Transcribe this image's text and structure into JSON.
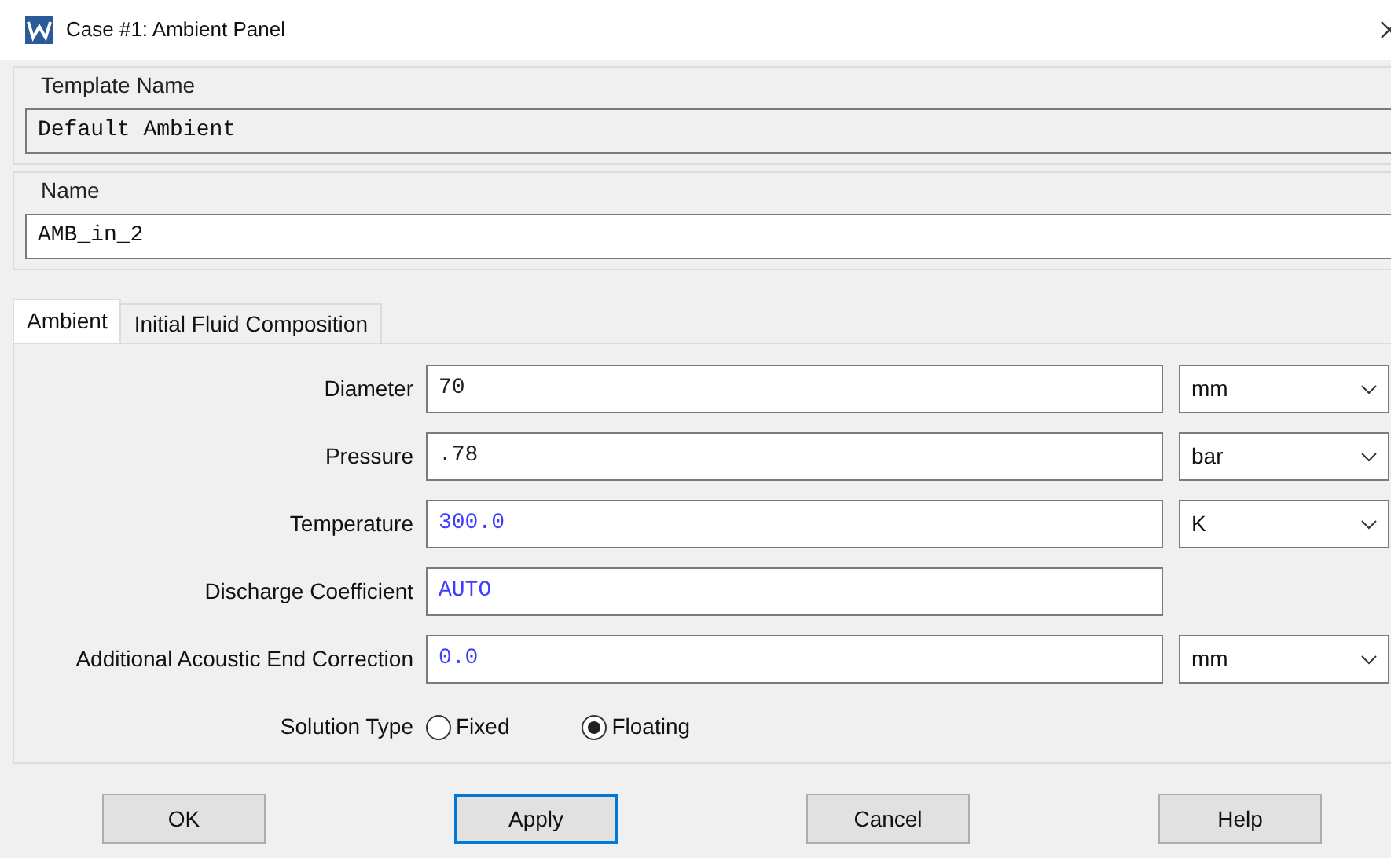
{
  "window": {
    "title": "Case #1: Ambient Panel"
  },
  "template_name": {
    "label": "Template Name",
    "value": "Default Ambient"
  },
  "name": {
    "label": "Name",
    "value": "AMB_in_2"
  },
  "tabs": [
    {
      "label": "Ambient",
      "selected": true
    },
    {
      "label": "Initial Fluid Composition",
      "selected": false
    }
  ],
  "rows": [
    {
      "kind": "field",
      "label": "Diameter",
      "value": "70",
      "computed": false,
      "unit": "mm"
    },
    {
      "kind": "field",
      "label": "Pressure",
      "value": ".78",
      "computed": false,
      "unit": "bar"
    },
    {
      "kind": "field",
      "label": "Temperature",
      "value": "300.0",
      "computed": true,
      "unit": "K"
    },
    {
      "kind": "field",
      "label": "Discharge Coefficient",
      "value": "AUTO",
      "computed": true
    },
    {
      "kind": "field",
      "label": "Additional Acoustic End Correction",
      "value": "0.0",
      "computed": true,
      "unit": "mm"
    },
    {
      "kind": "radio",
      "label": "Solution Type",
      "options": [
        {
          "label": "Fixed",
          "selected": false
        },
        {
          "label": "Floating",
          "selected": true
        }
      ]
    }
  ],
  "buttons": [
    {
      "label": "OK",
      "focused": false
    },
    {
      "label": "Apply",
      "focused": true
    },
    {
      "label": "Cancel",
      "focused": false
    },
    {
      "label": "Help",
      "focused": false
    }
  ]
}
